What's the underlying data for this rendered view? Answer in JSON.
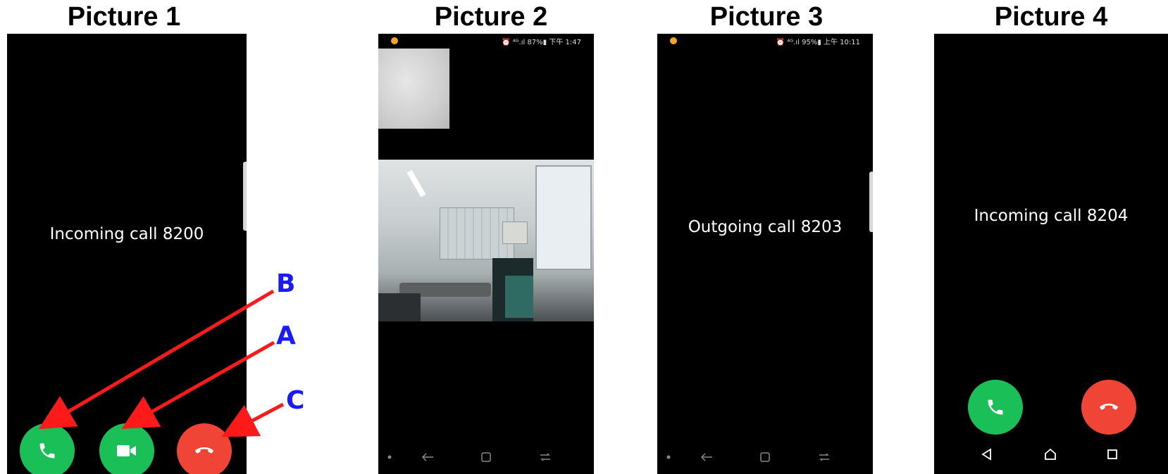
{
  "colors": {
    "accept_green": "#1bbf57",
    "decline_red": "#f04536",
    "annotation_red": "#ff1a1a",
    "annotation_blue": "#1a1aff"
  },
  "pictures": [
    {
      "title": "Picture 1",
      "call_text": "Incoming call 8200",
      "buttons": [
        {
          "icon": "phone-icon",
          "role": "voice-answer"
        },
        {
          "icon": "video-camera-icon",
          "role": "video-answer"
        },
        {
          "icon": "hang-up-icon",
          "role": "decline"
        }
      ],
      "annotations": [
        "B",
        "A",
        "C"
      ]
    },
    {
      "title": "Picture 2",
      "status_text": "⏰ ⁴ᴳ.ıl 87%▮ 下午 1:47",
      "nav_icons": [
        "dot-icon",
        "back-arrow-icon",
        "recent-apps-icon",
        "overview-icon"
      ]
    },
    {
      "title": "Picture 3",
      "status_text": "⏰ ⁴ᴳ.ıl 95%▮ 上午 10:11",
      "call_text": "Outgoing call 8203",
      "nav_icons": [
        "dot-icon",
        "back-arrow-icon",
        "recent-apps-icon",
        "overview-icon"
      ]
    },
    {
      "title": "Picture 4",
      "call_text": "Incoming call 8204",
      "buttons": [
        {
          "icon": "phone-icon",
          "role": "answer"
        },
        {
          "icon": "hang-up-icon",
          "role": "decline"
        }
      ],
      "nav_icons": [
        "back-triangle-icon",
        "home-icon",
        "recents-square-icon"
      ]
    }
  ]
}
